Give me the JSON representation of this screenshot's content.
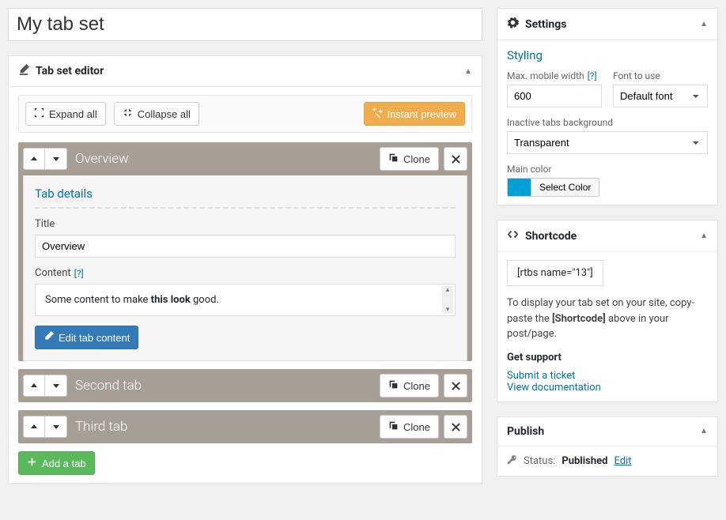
{
  "title_value": "My tab set",
  "editor": {
    "heading": "Tab set editor",
    "expand_label": "Expand all",
    "collapse_label": "Collapse all",
    "preview_label": "Instant preview",
    "add_tab_label": "Add a tab",
    "details_heading": "Tab details",
    "title_label": "Title",
    "content_label": "Content",
    "help_mark": "[?]",
    "edit_content_label": "Edit tab content",
    "clone_label": "Clone"
  },
  "tabs": [
    {
      "name": "Overview",
      "expanded": true,
      "title_value": "Overview",
      "content_html": "Some content to make <b>this look</b> good."
    },
    {
      "name": "Second tab",
      "expanded": false
    },
    {
      "name": "Third tab",
      "expanded": false
    }
  ],
  "settings": {
    "heading": "Settings",
    "styling_heading": "Styling",
    "mobile_width_label": "Max. mobile width",
    "mobile_width_value": "600",
    "font_label": "Font to use",
    "font_value": "Default font",
    "inactive_bg_label": "Inactive tabs background",
    "inactive_bg_value": "Transparent",
    "main_color_label": "Main color",
    "main_color_hex": "#00a0d2",
    "select_color_label": "Select Color"
  },
  "shortcode": {
    "heading": "Shortcode",
    "code": "[rtbs name=\"13\"]",
    "help_pre": "To display your tab set on your site, copy-paste the ",
    "help_bold": "[Shortcode]",
    "help_post": " above in your post/page.",
    "support_heading": "Get support",
    "submit_ticket": "Submit a ticket",
    "view_docs": "View documentation"
  },
  "publish": {
    "heading": "Publish",
    "status_prefix": "Status:",
    "status_value": "Published",
    "edit_label": "Edit"
  }
}
